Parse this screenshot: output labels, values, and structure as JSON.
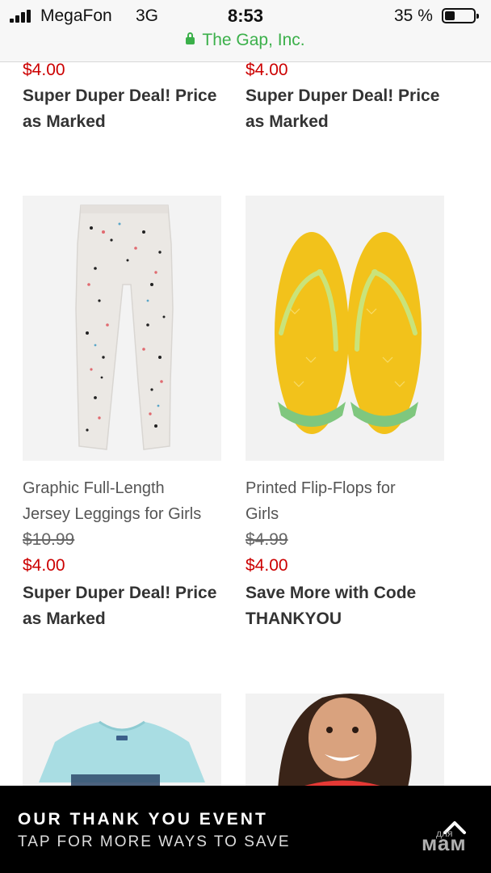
{
  "status_bar": {
    "carrier": "MegaFon",
    "network": "3G",
    "time": "8:53",
    "battery_percent": "35 %",
    "battery_level": 0.35,
    "site_name": "The Gap, Inc."
  },
  "products": {
    "top_left": {
      "sale_price": "$4.00",
      "deal": [
        "Super Duper Deal! Price",
        "as Marked"
      ]
    },
    "top_right": {
      "sale_price": "$4.00",
      "deal": [
        "Super Duper Deal! Price",
        "as Marked"
      ]
    },
    "leggings": {
      "name": [
        "Graphic Full-Length",
        "Jersey Leggings for Girls"
      ],
      "original_price": "$10.99",
      "sale_price": "$4.00",
      "deal": [
        "Super Duper Deal! Price",
        "as Marked"
      ]
    },
    "flipflops": {
      "name": [
        "Printed Flip-Flops for",
        "Girls"
      ],
      "original_price": "$4.99",
      "sale_price": "$4.00",
      "deal": [
        "Save More with Code",
        "THANKYOU"
      ]
    }
  },
  "banner": {
    "title": "OUR THANK YOU EVENT",
    "subtitle": "TAP FOR MORE WAYS TO SAVE",
    "watermark_top": "для",
    "watermark": "мам"
  },
  "colors": {
    "sale_red": "#cc0000",
    "secure_green": "#3bb04a",
    "banner_bg": "#000000"
  }
}
